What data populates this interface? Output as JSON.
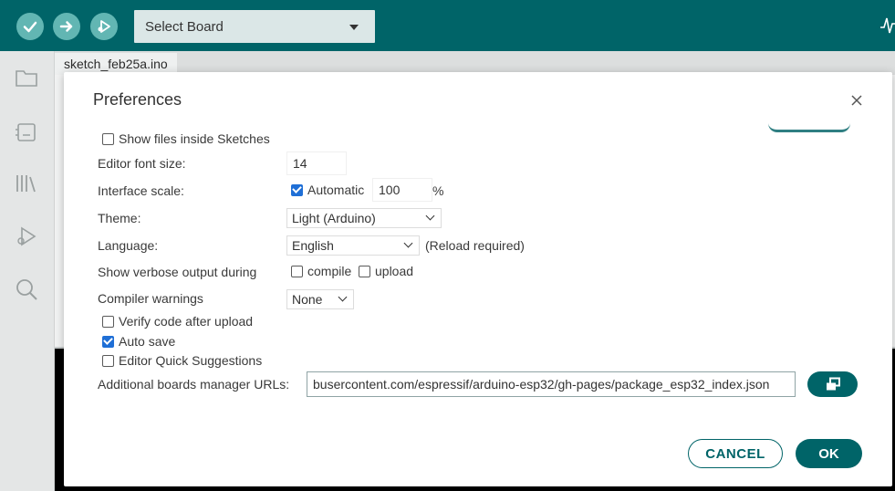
{
  "toolbar": {
    "board_select": "Select Board"
  },
  "editor": {
    "file_tab": "sketch_feb25a.ino"
  },
  "dialog": {
    "title": "Preferences",
    "show_files": {
      "label": "Show files inside Sketches",
      "checked": false
    },
    "font_size": {
      "label": "Editor font size:",
      "value": "14"
    },
    "interface_scale": {
      "label": "Interface scale:",
      "automatic_label": "Automatic",
      "automatic_checked": true,
      "value": "100",
      "unit": "%"
    },
    "theme": {
      "label": "Theme:",
      "value": "Light (Arduino)"
    },
    "language": {
      "label": "Language:",
      "value": "English",
      "note": "(Reload required)"
    },
    "verbose": {
      "label": "Show verbose output during",
      "compile_label": "compile",
      "upload_label": "upload",
      "compile_checked": false,
      "upload_checked": false
    },
    "compiler_warnings": {
      "label": "Compiler warnings",
      "value": "None"
    },
    "verify": {
      "label": "Verify code after upload",
      "checked": false
    },
    "auto_save": {
      "label": "Auto save",
      "checked": true
    },
    "quick_suggestions": {
      "label": "Editor Quick Suggestions",
      "checked": false
    },
    "boards_urls": {
      "label": "Additional boards manager URLs:",
      "value": "busercontent.com/espressif/arduino-esp32/gh-pages/package_esp32_index.json"
    },
    "cancel_label": "CANCEL",
    "ok_label": "OK"
  },
  "colors": {
    "accent": "#006468",
    "toolbar_button": "#62b6b3",
    "checkbox_checked": "#1f6fd6"
  }
}
